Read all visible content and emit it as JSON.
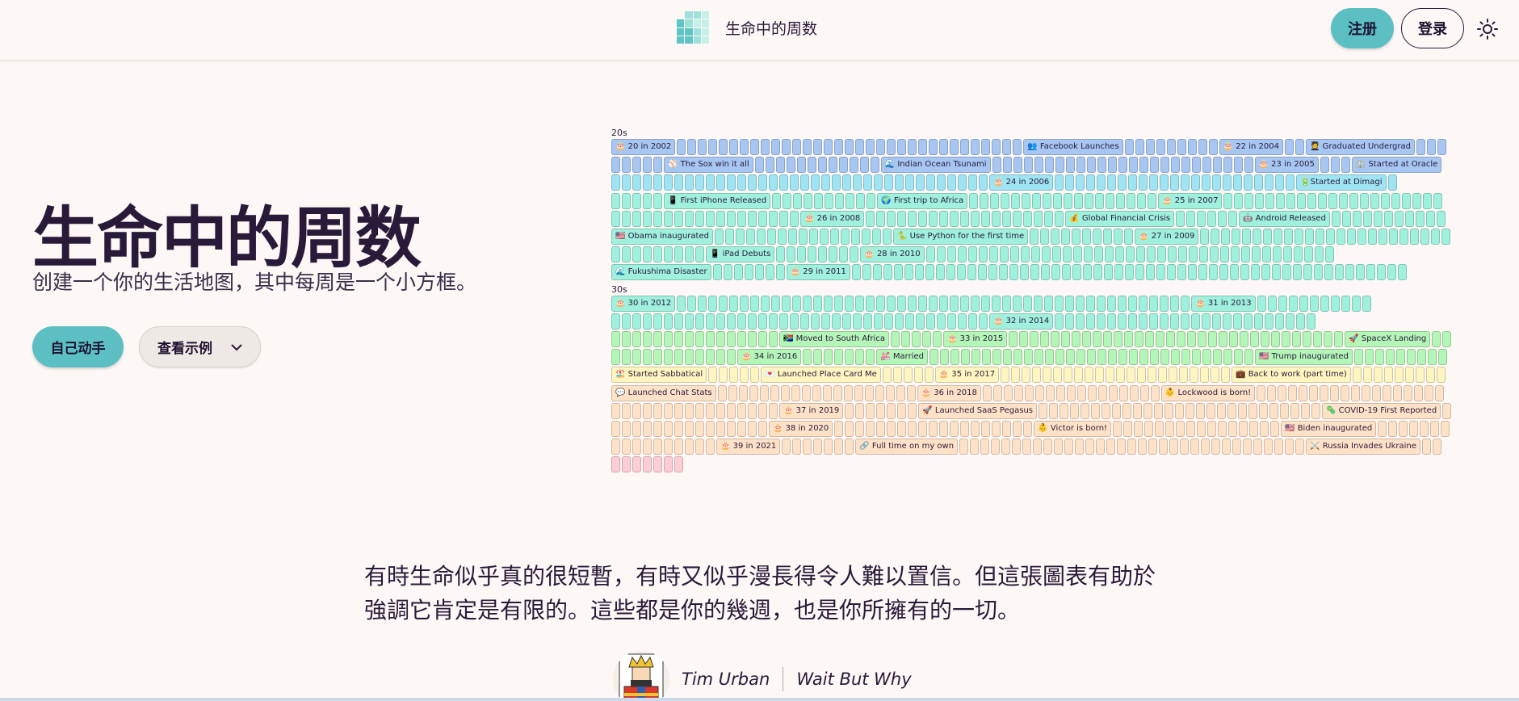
{
  "header": {
    "site_name": "生命中的周数",
    "register_label": "注册",
    "login_label": "登录",
    "theme_icon": "sun-icon"
  },
  "hero": {
    "title": "生命中的周数",
    "subtitle": "创建一个你的生活地图，其中每周是一个小方框。",
    "diy_label": "自己动手",
    "example_label": "查看示例"
  },
  "life_grid": {
    "decades": [
      {
        "label": "20s",
        "rows": [
          {
            "color": "blue",
            "events": [
              {
                "index": 0,
                "label": "🎂 20 in 2002"
              },
              {
                "index": 34,
                "label": "👥 Facebook Launches"
              },
              {
                "index": 44,
                "label": "🎂 22 in 2004"
              },
              {
                "index": 47,
                "label": "🧑‍🎓 Graduated Undergrad"
              }
            ],
            "cells": 62
          },
          {
            "color": "blue",
            "events": [
              {
                "index": 5,
                "label": "⚾ The Sox win it all"
              },
              {
                "index": 18,
                "label": "🌊 Indian Ocean Tsunami"
              },
              {
                "index": 44,
                "label": "🎂 23 in 2005"
              },
              {
                "index": 52,
                "label": "🏢 Started at Oracle"
              }
            ],
            "cells": 62
          },
          {
            "color": "sky",
            "events": [
              {
                "index": 36,
                "label": "🎂 24 in 2006"
              },
              {
                "index": 60,
                "label": "🔋Started at Dimagi"
              }
            ],
            "cells": 62
          },
          {
            "color": "mint",
            "events": [
              {
                "index": 5,
                "label": "📱 First iPhone Released"
              },
              {
                "index": 16,
                "label": "🌍 First trip to Africa"
              },
              {
                "index": 35,
                "label": "🎂 25 in 2007"
              }
            ],
            "cells": 62
          },
          {
            "color": "mint",
            "events": [
              {
                "index": 18,
                "label": "🎂 26 in 2008"
              },
              {
                "index": 38,
                "label": "💰 Global Financial Crisis"
              },
              {
                "index": 45,
                "label": "🤖 Android Released"
              }
            ],
            "cells": 62
          },
          {
            "color": "mint",
            "events": [
              {
                "index": 0,
                "label": "🇺🇸 Obama inaugurated"
              },
              {
                "index": 18,
                "label": "🐍 Use Python for the first time"
              },
              {
                "index": 29,
                "label": "🎂 27 in 2009"
              }
            ],
            "cells": 62
          },
          {
            "color": "mint",
            "events": [
              {
                "index": 9,
                "label": "📱 iPad Debuts"
              },
              {
                "index": 18,
                "label": "🎂 28 in 2010"
              }
            ],
            "cells": 58
          },
          {
            "color": "mint",
            "events": [
              {
                "index": 0,
                "label": "🌊 Fukushima Disaster"
              },
              {
                "index": 8,
                "label": "🎂 29 in 2011"
              }
            ],
            "cells": 62
          }
        ]
      },
      {
        "label": "30s",
        "rows": [
          {
            "color": "mint",
            "events": [
              {
                "index": 0,
                "label": "🎂 30 in 2012"
              },
              {
                "index": 50,
                "label": "🎂 31 in 2013"
              }
            ],
            "cells": 62
          },
          {
            "color": "mint",
            "events": [
              {
                "index": 36,
                "label": "🎂 32 in 2014"
              }
            ],
            "cells": 62
          },
          {
            "color": "green",
            "events": [
              {
                "index": 16,
                "label": "🇿🇦 Moved to South Africa"
              },
              {
                "index": 22,
                "label": "🎂 33 in 2015"
              },
              {
                "index": 55,
                "label": "🚀 SpaceX Landing"
              }
            ],
            "cells": 62
          },
          {
            "color": "green",
            "events": [
              {
                "index": 12,
                "label": "🎂 34 in 2016"
              },
              {
                "index": 20,
                "label": "💒 Married"
              },
              {
                "index": 52,
                "label": "🇺🇸 Trump inaugurated"
              }
            ],
            "cells": 62
          },
          {
            "color": "yellow",
            "events": [
              {
                "index": 0,
                "label": "🏖️ Started Sabbatical"
              },
              {
                "index": 6,
                "label": "💌 Launched Place Card Me"
              },
              {
                "index": 12,
                "label": "🎂 35 in 2017"
              },
              {
                "index": 35,
                "label": "💼 Back to work (part time)"
              }
            ],
            "cells": 54
          },
          {
            "color": "peach",
            "events": [
              {
                "index": 0,
                "label": "💬 Launched Chat Stats"
              },
              {
                "index": 20,
                "label": "🎂 36 in 2018"
              },
              {
                "index": 38,
                "label": "👶 Lockwood is born!"
              }
            ],
            "cells": 62
          },
          {
            "color": "peach",
            "events": [
              {
                "index": 16,
                "label": "🎂 37 in 2019"
              },
              {
                "index": 24,
                "label": "🚀 Launched SaaS Pegasus"
              },
              {
                "index": 52,
                "label": "🦠 COVID-19 First Reported"
              }
            ],
            "cells": 62
          },
          {
            "color": "peach",
            "events": [
              {
                "index": 15,
                "label": "🎂 38 in 2020"
              },
              {
                "index": 35,
                "label": "👶 Victor is born!"
              },
              {
                "index": 52,
                "label": "🇺🇸 Biden inaugurated"
              }
            ],
            "cells": 62
          },
          {
            "color": "peach",
            "events": [
              {
                "index": 10,
                "label": "🎂 39 in 2021"
              },
              {
                "index": 18,
                "label": "🔗 Full time on my own"
              },
              {
                "index": 52,
                "label": "⚔️ Russia Invades Ukraine"
              }
            ],
            "cells": 62
          },
          {
            "color": "pink",
            "events": [],
            "cells": 7
          }
        ]
      }
    ]
  },
  "quote": {
    "text": "有時生命似乎真的很短暫，有時又似乎漫長得令人難以置信。但這張圖表有助於強調它肯定是有限的。這些都是你的幾週，也是你所擁有的一切。",
    "author": "Tim Urban",
    "source": "Wait But Why"
  }
}
